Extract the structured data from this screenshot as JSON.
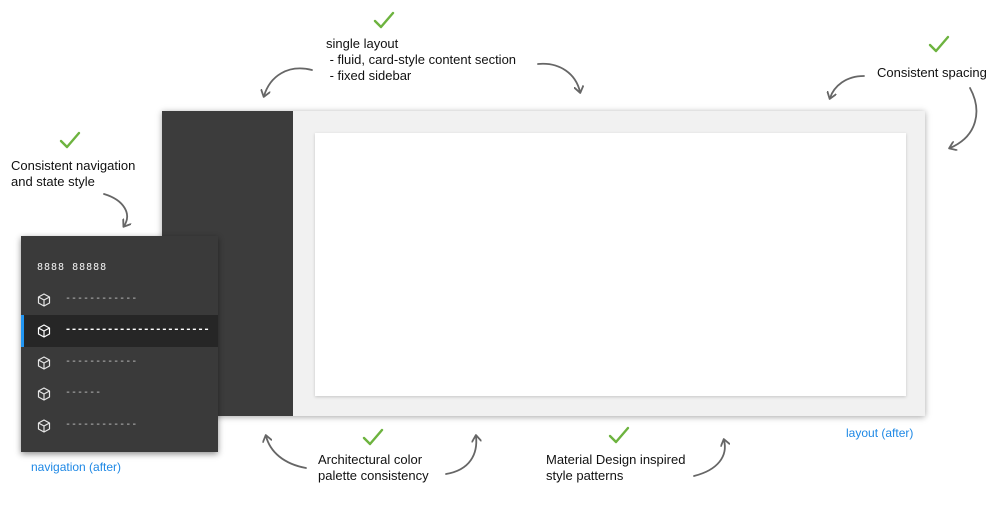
{
  "notes": {
    "single_layout": "single layout\n - fluid, card-style content section\n - fixed sidebar",
    "consistent_spacing": "Consistent spacing",
    "consistent_navigation": "Consistent navigation\nand state style",
    "color_palette": "Architectural color\npalette consistency",
    "material_design": "Material Design inspired\nstyle patterns"
  },
  "captions": {
    "layout": "layout (after)",
    "navigation": "navigation (after)"
  },
  "nav": {
    "title": "8888 88888",
    "items": [
      {
        "label": "------------",
        "active": false
      },
      {
        "label": "------------------------",
        "active": true
      },
      {
        "label": "------------",
        "active": false
      },
      {
        "label": "------",
        "active": false
      },
      {
        "label": "------------",
        "active": false
      }
    ]
  },
  "colors": {
    "check": "#6db33f",
    "accent": "#2196f3",
    "caption": "#1e88e5",
    "sidebar": "#3c3c3c",
    "nav_bg": "#3a3a3a",
    "nav_active_bg": "#262626"
  },
  "icons": {
    "check": "checkmark-icon",
    "arrow": "curved-arrow-icon",
    "nav_item": "cube-icon"
  }
}
